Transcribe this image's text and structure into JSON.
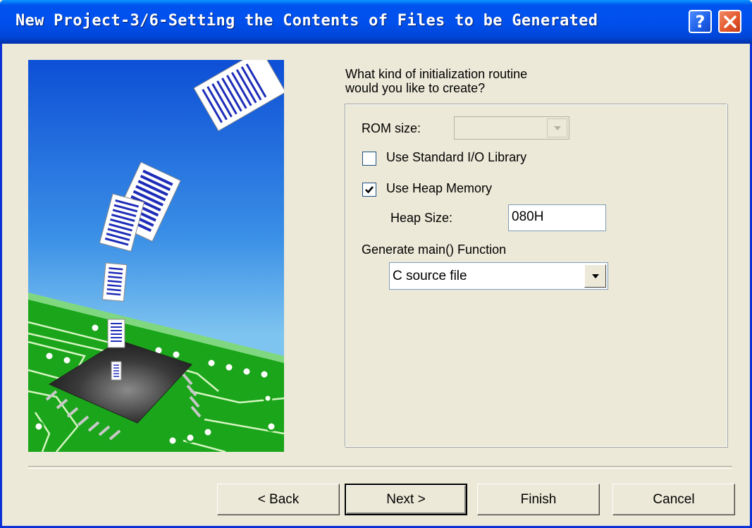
{
  "window": {
    "title": "New Project-3/6-Setting the Contents of Files to be Generated",
    "help_label": "?",
    "close_label": "✕"
  },
  "prompt": {
    "line1": "What kind of initialization routine",
    "line2": "would you like to create?"
  },
  "options": {
    "rom_size_label": "ROM size:",
    "rom_size_value": "",
    "rom_size_enabled": false,
    "std_io_label": "Use Standard I/O Library",
    "std_io_checked": false,
    "heap_label": "Use Heap Memory",
    "heap_checked": true,
    "heap_size_label": "Heap Size:",
    "heap_size_value": "080H",
    "main_func_label": "Generate main() Function",
    "main_func_value": "C source file"
  },
  "buttons": {
    "back": "< Back",
    "next": "Next >",
    "finish": "Finish",
    "cancel": "Cancel"
  },
  "colors": {
    "titlebar": "#0050ee",
    "dialog_bg": "#ece9d8",
    "sky_top": "#0d4fd6",
    "sky_bottom": "#7ec4f0",
    "board_green": "#1aa51a"
  },
  "icons": {
    "help": "help-icon",
    "close": "close-icon",
    "dropdown": "chevron-down-icon",
    "check": "checkmark-icon"
  }
}
